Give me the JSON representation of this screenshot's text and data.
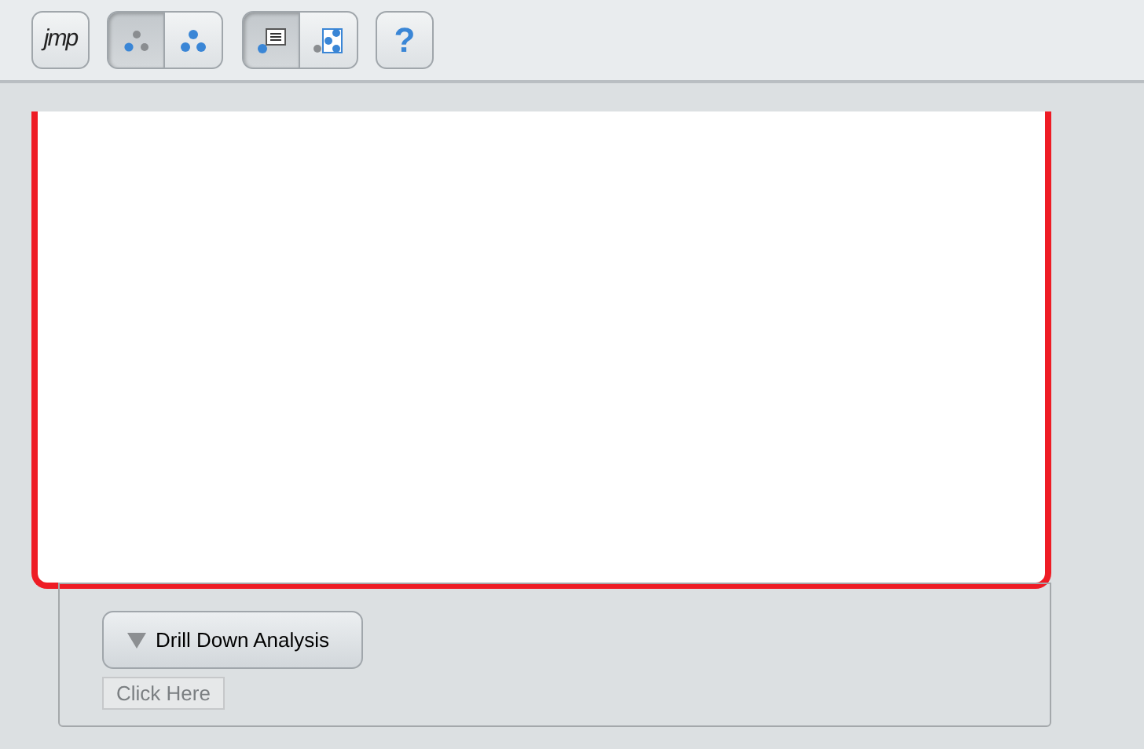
{
  "toolbar": {
    "logo": "jmp",
    "groups": [
      {
        "kind": "points",
        "buttons": [
          {
            "selected": true
          },
          {
            "selected": false
          }
        ]
      },
      {
        "kind": "labels",
        "buttons": [
          {
            "selected": true
          },
          {
            "selected": false
          }
        ]
      }
    ],
    "help": "?"
  },
  "outline": {
    "title": "Drill Down Analysis",
    "expanded": true,
    "link": "Click Here"
  }
}
